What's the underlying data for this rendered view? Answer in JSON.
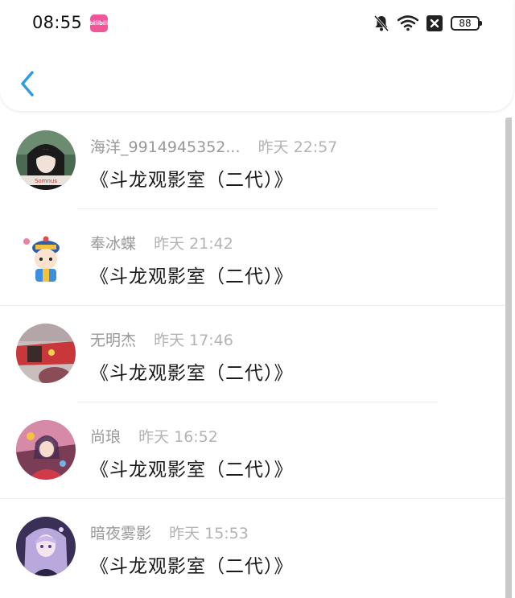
{
  "status_bar": {
    "time": "08:55",
    "app_badge_label": "bilibili",
    "battery": "88",
    "icons": [
      "app-badge-icon",
      "bell-muted-icon",
      "wifi-icon",
      "close-box-icon",
      "battery-icon"
    ]
  },
  "nav": {
    "back_icon": "chevron-left-icon",
    "accent_color": "#2b9be6"
  },
  "messages": [
    {
      "name": "海洋_9914945352...",
      "time": "昨天 22:57",
      "text": "《斗龙观影室（二代）》",
      "avatar": "anime-girl-dark-hair-avatar"
    },
    {
      "name": "奉冰蝶",
      "time": "昨天 21:42",
      "text": "《斗龙观影室（二代）》",
      "avatar": "cartoon-prince-avatar"
    },
    {
      "name": "无明杰",
      "time": "昨天 17:46",
      "text": "《斗龙观影室（二代）》",
      "avatar": "red-character-avatar"
    },
    {
      "name": "尚琅",
      "time": "昨天 16:52",
      "text": "《斗龙观影室（二代）》",
      "avatar": "colorful-anime-avatar"
    },
    {
      "name": "暗夜雾影",
      "time": "昨天 15:53",
      "text": "《斗龙观影室（二代）》",
      "avatar": "purple-anime-girl-avatar"
    }
  ],
  "colors": {
    "name_text": "#999999",
    "time_text": "#b3b3b3",
    "message_text": "#1a1a1a",
    "divider": "#ececec"
  }
}
